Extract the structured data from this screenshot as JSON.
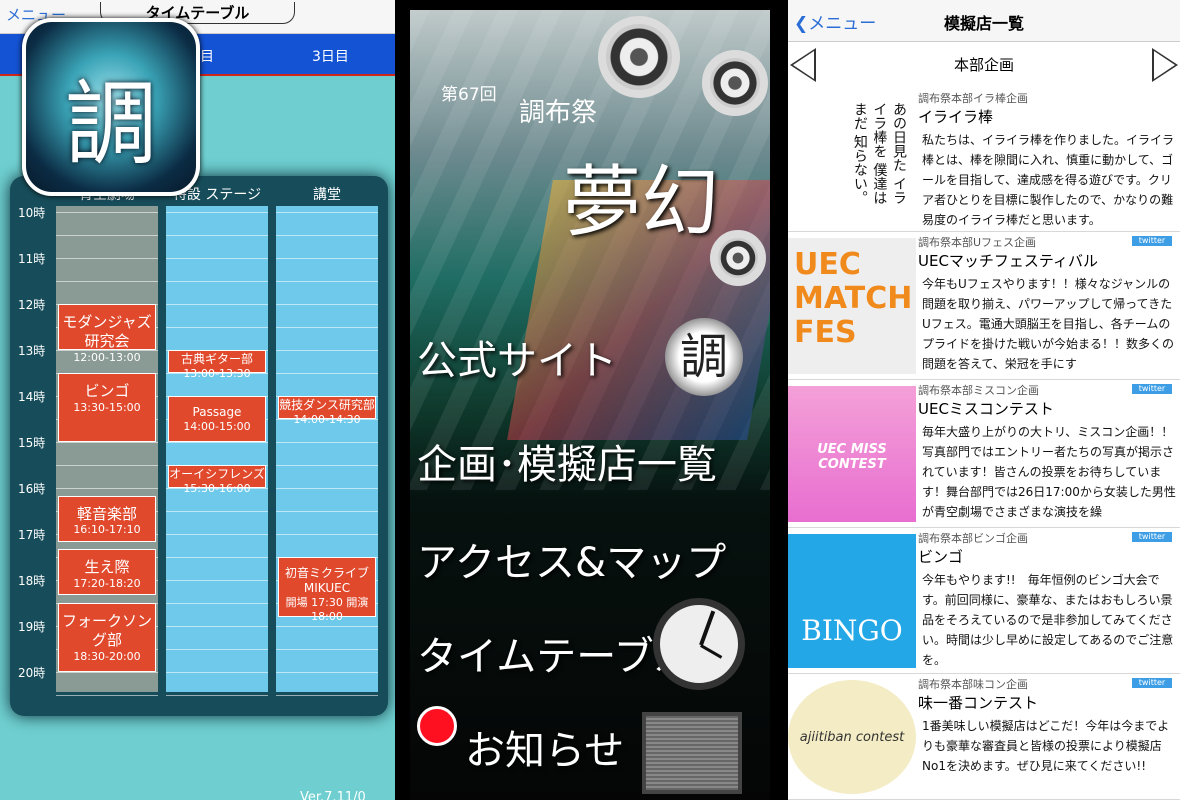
{
  "timetable": {
    "menu_label": "メニュー",
    "title": "タイムテーブル",
    "day_tabs": [
      "目",
      "3日目"
    ],
    "app_icon_glyph": "調",
    "columns": [
      "青空劇場",
      "特設 ステージ",
      "講堂"
    ],
    "hours": [
      "10時",
      "11時",
      "12時",
      "13時",
      "14時",
      "15時",
      "16時",
      "17時",
      "18時",
      "19時",
      "20時"
    ],
    "events": [
      {
        "col": 0,
        "name": "モダンジャズ研究会",
        "time": "12:00-13:00",
        "start": 12.0,
        "end": 13.0
      },
      {
        "col": 0,
        "name": "ビンゴ",
        "time": "13:30-15:00",
        "start": 13.5,
        "end": 15.0
      },
      {
        "col": 0,
        "name": "軽音楽部",
        "time": "16:10-17:10",
        "start": 16.1667,
        "end": 17.1667
      },
      {
        "col": 0,
        "name": "生え際",
        "time": "17:20-18:20",
        "start": 17.3333,
        "end": 18.3333
      },
      {
        "col": 0,
        "name": "フォークソング部",
        "time": "18:30-20:00",
        "start": 18.5,
        "end": 20.0
      },
      {
        "col": 1,
        "name": "古典ギター部",
        "time": "13:00-13:30",
        "start": 13.0,
        "end": 13.5
      },
      {
        "col": 1,
        "name": "Passage",
        "time": "14:00-15:00",
        "start": 14.0,
        "end": 15.0
      },
      {
        "col": 1,
        "name": "オーイシフレンズ",
        "time": "15:30-16:00",
        "start": 15.5,
        "end": 16.0
      },
      {
        "col": 2,
        "name": "競技ダンス研究部",
        "time": "14:00-14:30",
        "start": 14.0,
        "end": 14.5
      },
      {
        "col": 2,
        "name": "初音ミクライブ MIKUEC",
        "time": "開場 17:30 開演 18:00",
        "start": 17.5,
        "end": 18.8
      }
    ],
    "version": "Ver.7.11/0"
  },
  "home": {
    "edition": "第67回",
    "festival": "調布祭",
    "theme": "夢幻",
    "menu": [
      "公式サイト",
      "企画･模擬店一覧",
      "アクセス&マップ",
      "タイムテーブル",
      "お知らせ"
    ],
    "seal_glyph": "調",
    "colors": {
      "notice_dot": "#ff1020"
    }
  },
  "stalls": {
    "back_label": "メニュー",
    "title": "模擬店一覧",
    "category": "本部企画",
    "twitter_label": "twitter",
    "items": [
      {
        "org": "調布祭本部イラ棒企画",
        "title": "イライラ棒",
        "twitter": false,
        "thumb_text": "あの日見た イライラ棒を 僕達はまだ 知らない。",
        "desc": "私たちは、イライラ棒を作りました。イライラ棒とは、棒を隙間に入れ、慎重に動かして、ゴールを目指して、達成感を得る遊びです。クリア者ひとりを目標に製作したので、かなりの難易度のイライラ棒だと思います。"
      },
      {
        "org": "調布祭本部Uフェス企画",
        "title": "UECマッチフェスティバル",
        "twitter": true,
        "thumb_text": "UEC MATCH FES",
        "desc": "今年もUフェスやります！！様々なジャンルの問題を取り揃え、パワーアップして帰ってきたUフェス。電通大頭脳王を目指し、各チームのプライドを掛けた戦いが今始まる！！数多くの問題を答えて、栄冠を手にす"
      },
      {
        "org": "調布祭本部ミスコン企画",
        "title": "UECミスコンテスト",
        "twitter": true,
        "thumb_text": "UEC MISS CONTEST",
        "desc": "毎年大盛り上がりの大トリ、ミスコン企画！！写真部門ではエントリー者たちの写真が掲示されています！皆さんの投票をお待ちしています！舞台部門では26日17:00から女装した男性が青空劇場でさまざまな演技を繰"
      },
      {
        "org": "調布祭本部ビンゴ企画",
        "title": "ビンゴ",
        "twitter": true,
        "thumb_text": "BINGO",
        "desc": "今年もやります!!　毎年恒例のビンゴ大会です。前回同様に、豪華な、またはおもしろい景品をそろえているので是非参加してみてください。時間は少し早めに設定してあるのでご注意を。"
      },
      {
        "org": "調布祭本部味コン企画",
        "title": "味一番コンテスト",
        "twitter": true,
        "thumb_text": "ajiitiban contest",
        "desc": "1番美味しい模擬店はどこだ！今年は今までよりも豪華な審査員と皆様の投票により模擬店No1を決めます。ぜひ見に来てください!!"
      }
    ]
  }
}
